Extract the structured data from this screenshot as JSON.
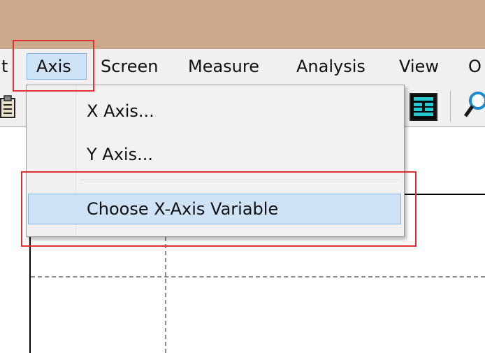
{
  "menubar": {
    "items": [
      {
        "label": "t"
      },
      {
        "label": "Axis"
      },
      {
        "label": "Screen"
      },
      {
        "label": "Measure"
      },
      {
        "label": "Analysis"
      },
      {
        "label": "View"
      },
      {
        "label": "O"
      }
    ]
  },
  "axis_menu": {
    "items": [
      {
        "label": "X Axis..."
      },
      {
        "label": "Y Axis..."
      },
      {
        "label": "Choose X-Axis Variable"
      }
    ]
  },
  "icons": {
    "left": "clipboard-icon",
    "right_1": "spreadsheet-icon",
    "right_2": "magnifier-icon"
  },
  "colors": {
    "highlight": "#cfe3f7",
    "highlight_border": "#7eb4ea",
    "callout": "#e03030",
    "title_strip": "#c9a98a"
  }
}
